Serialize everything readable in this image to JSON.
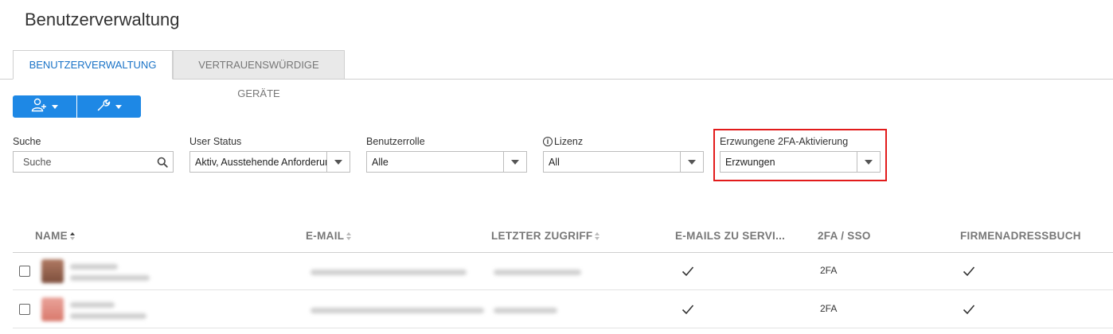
{
  "page": {
    "title": "Benutzerverwaltung"
  },
  "tabs": [
    {
      "label": "BENUTZERVERWALTUNG",
      "active": true
    },
    {
      "label": "VERTRAUENSWÜRDIGE GERÄTE",
      "active": false
    }
  ],
  "toolbar": {
    "add_user_icon": "add-user-icon",
    "tools_icon": "wrench-icon",
    "accent": "#1e88e5"
  },
  "filters": {
    "search": {
      "label": "Suche",
      "placeholder": "Suche"
    },
    "user_status": {
      "label": "User Status",
      "value": "Aktiv, Ausstehende Anforderung"
    },
    "role": {
      "label": "Benutzerrolle",
      "value": "Alle"
    },
    "license": {
      "label": "Lizenz",
      "value": "All"
    },
    "twofa": {
      "label": "Erzwungene 2FA-Aktivierung",
      "value": "Erzwungen",
      "highlight_color": "#e21b1b"
    }
  },
  "table": {
    "columns": [
      {
        "label": "NAME",
        "sortable": true,
        "sorted": "asc"
      },
      {
        "label": "E-MAIL",
        "sortable": true
      },
      {
        "label": "LETZTER ZUGRIFF",
        "sortable": true
      },
      {
        "label": "E-MAILS ZU SERVI...",
        "sortable": false
      },
      {
        "label": "2FA / SSO",
        "sortable": false
      },
      {
        "label": "FIRMENADRESSBUCH",
        "sortable": false
      }
    ],
    "rows": [
      {
        "emails_to_service": "✓",
        "twofa_sso": "2FA",
        "company_address_book": "✓"
      },
      {
        "emails_to_service": "✓",
        "twofa_sso": "2FA",
        "company_address_book": "✓"
      }
    ]
  }
}
